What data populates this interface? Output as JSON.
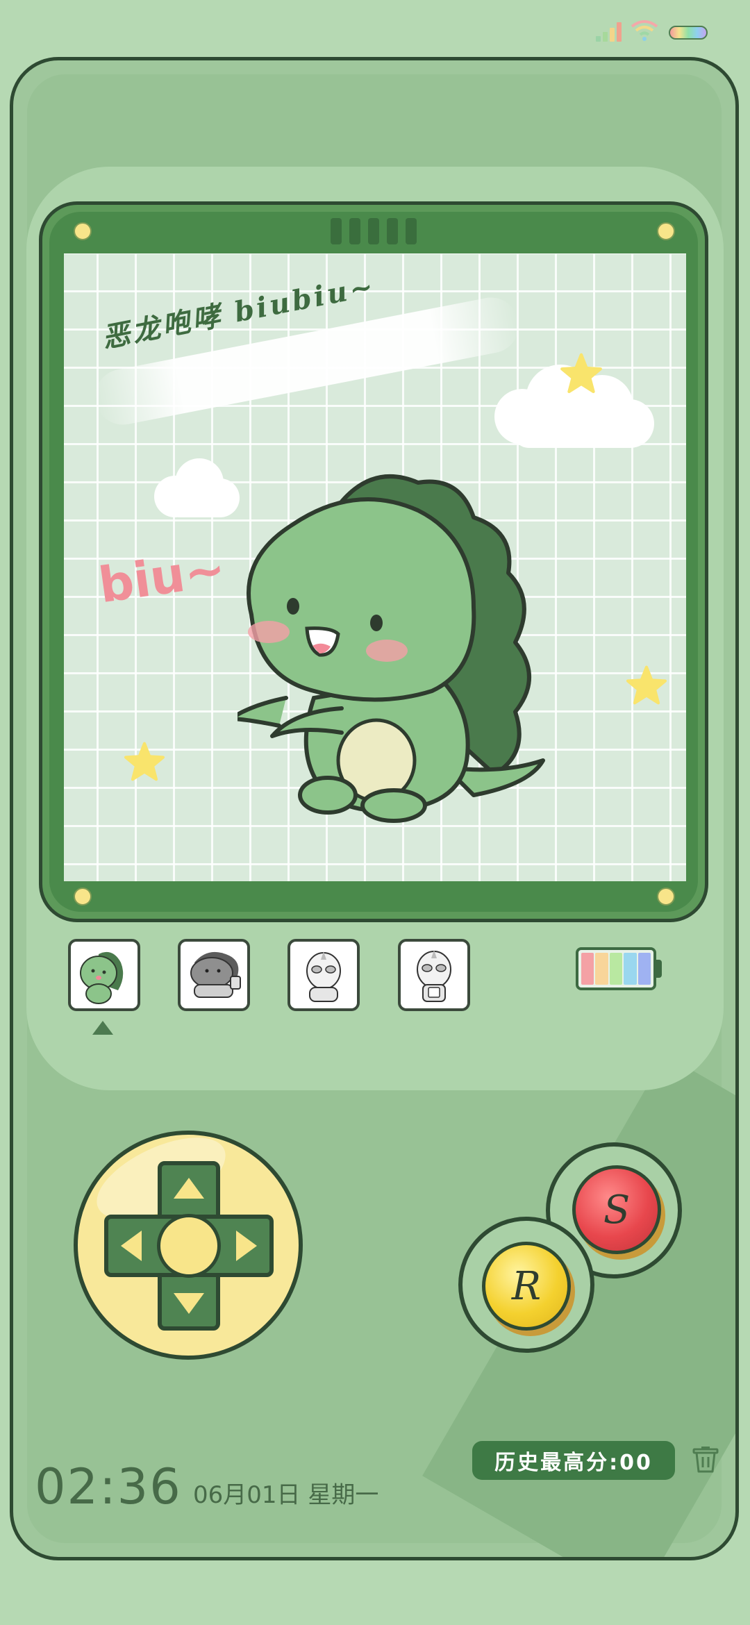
{
  "status_bar": {
    "icons": [
      "signal-icon",
      "wifi-icon",
      "battery-icon"
    ]
  },
  "screen": {
    "title_text": "恶龙咆哮 biubiu~",
    "biu_text": "biu~"
  },
  "theme_selector": {
    "thumbnails": [
      {
        "name": "green-dinosaur",
        "selected": true
      },
      {
        "name": "gray-dinosaur",
        "selected": false
      },
      {
        "name": "ultraman-1",
        "selected": false
      },
      {
        "name": "ultraman-2",
        "selected": false
      }
    ]
  },
  "buttons": {
    "s_label": "S",
    "r_label": "R"
  },
  "clock": {
    "time": "02:36",
    "date": "06月01日 星期一"
  },
  "score": {
    "label": "历史最高分:00"
  },
  "colors": {
    "body": "#9fc79c",
    "outline": "#2e4a32",
    "accent_yellow": "#f8e58a",
    "s_button": "#e8474d",
    "r_button": "#f4d12f"
  }
}
